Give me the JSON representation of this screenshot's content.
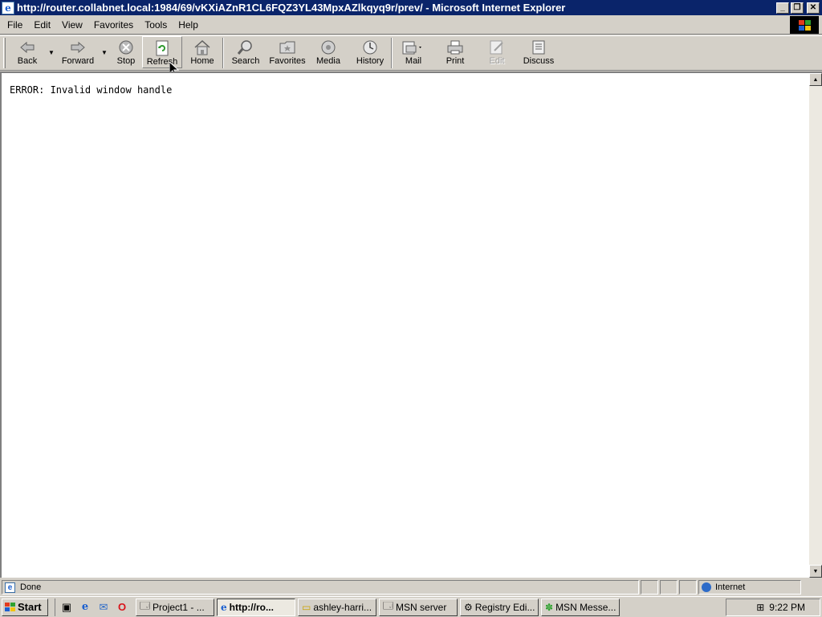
{
  "window": {
    "title": "http://router.collabnet.local:1984/69/vKXiAZnR1CL6FQZ3YL43MpxAZlkqyq9r/prev/ - Microsoft Internet Explorer",
    "minimize": "_",
    "restore": "❐",
    "close": "✕"
  },
  "menu": [
    "File",
    "Edit",
    "View",
    "Favorites",
    "Tools",
    "Help"
  ],
  "toolbar": {
    "back": "Back",
    "forward": "Forward",
    "stop": "Stop",
    "refresh": "Refresh",
    "home": "Home",
    "search": "Search",
    "favorites": "Favorites",
    "media": "Media",
    "history": "History",
    "mail": "Mail",
    "print": "Print",
    "edit": "Edit",
    "discuss": "Discuss"
  },
  "content": {
    "message": "ERROR: Invalid window handle"
  },
  "status": {
    "text": "Done",
    "zone": "Internet"
  },
  "taskbar": {
    "start": "Start",
    "tasks": [
      "Project1 - ...",
      "http://ro...",
      "ashley-harri...",
      "MSN server",
      "Registry Edi...",
      "MSN Messe..."
    ],
    "time": "9:22 PM"
  },
  "colors": {
    "titlebar": "#0a246a",
    "face": "#d4d0c8"
  }
}
